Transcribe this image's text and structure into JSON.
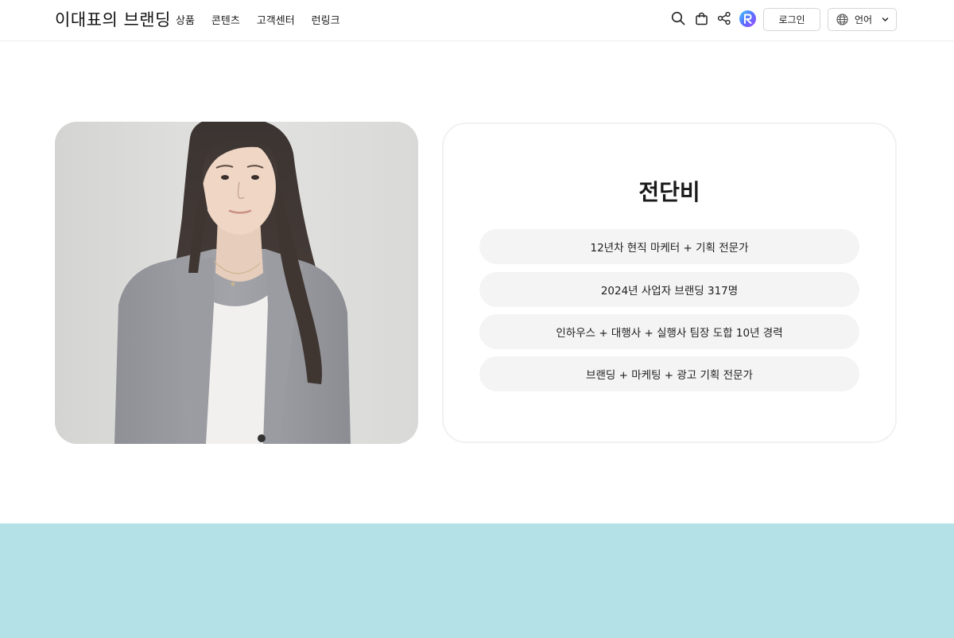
{
  "header": {
    "brand": "이대표의 브랜딩",
    "nav": [
      "상품",
      "콘텐츠",
      "고객센터",
      "런링크"
    ],
    "icons": [
      "search-icon",
      "shopping-bag-icon",
      "share-icon",
      "app-logo-icon"
    ],
    "login_label": "로그인",
    "language_label": "언어"
  },
  "profile": {
    "name": "전단비",
    "highlights": [
      "12년차 현직 마케터 + 기획 전문가",
      "2024년 사업자 브랜딩 317명",
      "인하우스 + 대행사 + 실행사 팀장 도합 10년 경력",
      "브랜딩 + 마케팅 + 광고 기획 전문가"
    ]
  },
  "colors": {
    "band": "#b4e1e7",
    "pill_background": "#f4f4f4",
    "header_border": "#ebebeb"
  }
}
